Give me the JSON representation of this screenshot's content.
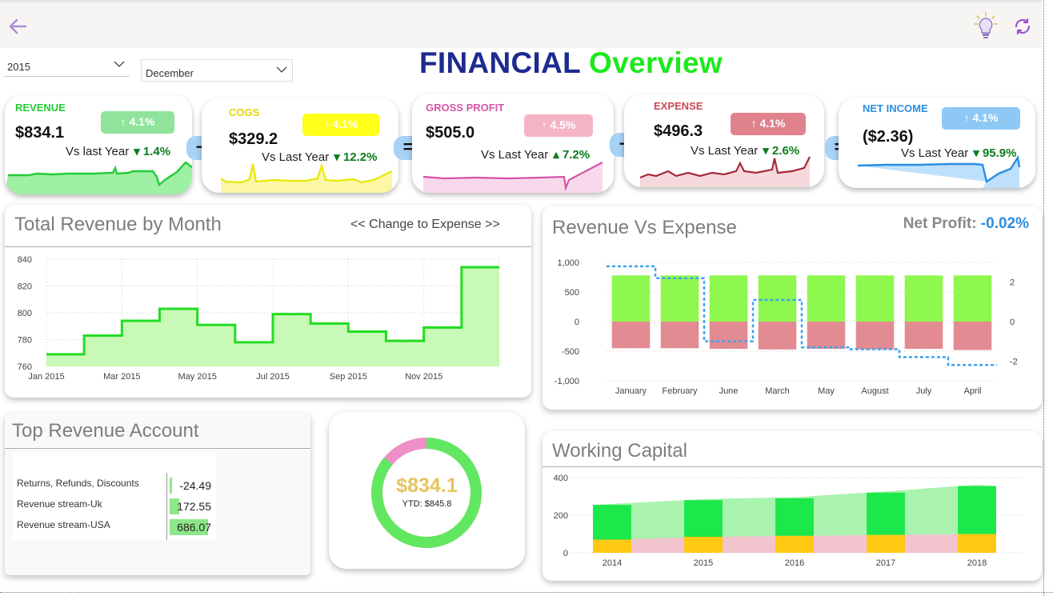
{
  "topbar": {
    "back_icon": "back-arrow-icon",
    "bulb_icon": "lightbulb-icon",
    "refresh_icon": "refresh-icon"
  },
  "filters": {
    "year": "2015",
    "month": "December"
  },
  "title": {
    "part1": "FINANCIAL",
    "part2": "Overview"
  },
  "kpis": [
    {
      "label": "REVENUE",
      "value": "$834.1",
      "badge": "↑ 4.1%",
      "vs_label": "Vs last Year",
      "vs_pct": "1.4%",
      "vs_arrow": "down",
      "color": "#22cc33"
    },
    {
      "label": "COGS",
      "value": "$329.2",
      "badge": "↑ 4.1%",
      "vs_label": "Vs Last Year",
      "vs_pct": "12.2%",
      "vs_arrow": "down",
      "color": "#e8e800"
    },
    {
      "label": "GROSS PROFIT",
      "value": "$505.0",
      "badge": "↑ 4.5%",
      "vs_label": "Vs Last Year",
      "vs_pct": "7.2%",
      "vs_arrow": "up",
      "color": "#d455a8"
    },
    {
      "label": "EXPENSE",
      "value": "$496.3",
      "badge": "↑ 4.1%",
      "vs_label": "Vs Last Year",
      "vs_pct": "2.6%",
      "vs_arrow": "down",
      "color": "#a52a3a"
    },
    {
      "label": "NET INCOME",
      "value": "($2.36)",
      "badge": "↑ 4.1%",
      "vs_label": "Vs Last Year",
      "vs_pct": "95.9%",
      "vs_arrow": "down",
      "color": "#2b8de0"
    }
  ],
  "operators": [
    "−",
    "=",
    "−",
    "="
  ],
  "total_revenue": {
    "title": "Total Revenue by Month",
    "toggle": "<< Change to Expense >>"
  },
  "revenue_vs_expense": {
    "title": "Revenue Vs Expense",
    "net_profit_label": "Net Profit:",
    "net_profit_value": "-0.02%"
  },
  "top_revenue": {
    "title": "Top Revenue Account",
    "rows": [
      {
        "name": "Returns, Refunds, Discounts",
        "value": "-24.49",
        "num": -24.49
      },
      {
        "name": "Revenue stream-Uk",
        "value": "172.55",
        "num": 172.55
      },
      {
        "name": "Revenue stream-USA",
        "value": "686.07",
        "num": 686.07
      }
    ]
  },
  "donut": {
    "value": "$834.1",
    "ytd": "YTD: $845.8",
    "fraction": 0.86
  },
  "working_capital": {
    "title": "Working Capital"
  },
  "chart_data": [
    {
      "type": "area",
      "x": [
        "Jan 2015",
        "Feb 2015",
        "Mar 2015",
        "Apr 2015",
        "May 2015",
        "Jun 2015",
        "Jul 2015",
        "Aug 2015",
        "Sep 2015",
        "Oct 2015",
        "Nov 2015",
        "Dec 2015"
      ],
      "xticks": [
        "Jan 2015",
        "Mar 2015",
        "May 2015",
        "Jul 2015",
        "Sep 2015",
        "Nov 2015"
      ],
      "values": [
        769,
        783,
        794,
        803,
        791,
        778,
        799,
        792,
        786,
        779,
        789,
        834
      ],
      "ylim": [
        760,
        840
      ],
      "yticks": [
        "760",
        "780",
        "800",
        "820",
        "840"
      ],
      "grid": true
    },
    {
      "type": "bar",
      "categories": [
        "January",
        "February",
        "June",
        "March",
        "May",
        "August",
        "July",
        "April"
      ],
      "series": [
        {
          "values": [
            780,
            780,
            780,
            780,
            780,
            780,
            780,
            780
          ]
        },
        {
          "values": [
            -450,
            -450,
            -460,
            -470,
            -460,
            -470,
            -460,
            -480
          ]
        }
      ],
      "line_values": [
        2.8,
        2.2,
        -1.0,
        1.1,
        -1.3,
        -1.4,
        -1.8,
        -2.2
      ],
      "ylim": [
        -1000,
        1000
      ],
      "yticks": [
        "-1,000",
        "-500",
        "0",
        "500",
        "1,000"
      ],
      "y2lim": [
        -3,
        3
      ],
      "y2ticks": [
        "-2",
        "0",
        "2"
      ],
      "grid": true
    },
    {
      "type": "bar",
      "categories": [
        "2014",
        "2015",
        "2016",
        "2017",
        "2018"
      ],
      "series": [
        {
          "values": [
            255,
            280,
            290,
            320,
            355
          ]
        },
        {
          "values": [
            70,
            85,
            90,
            95,
            100
          ]
        }
      ],
      "area_values": [
        255,
        280,
        290,
        320,
        355
      ],
      "ylim": [
        0,
        400
      ],
      "yticks": [
        "0",
        "200",
        "400"
      ],
      "grid": true
    }
  ]
}
